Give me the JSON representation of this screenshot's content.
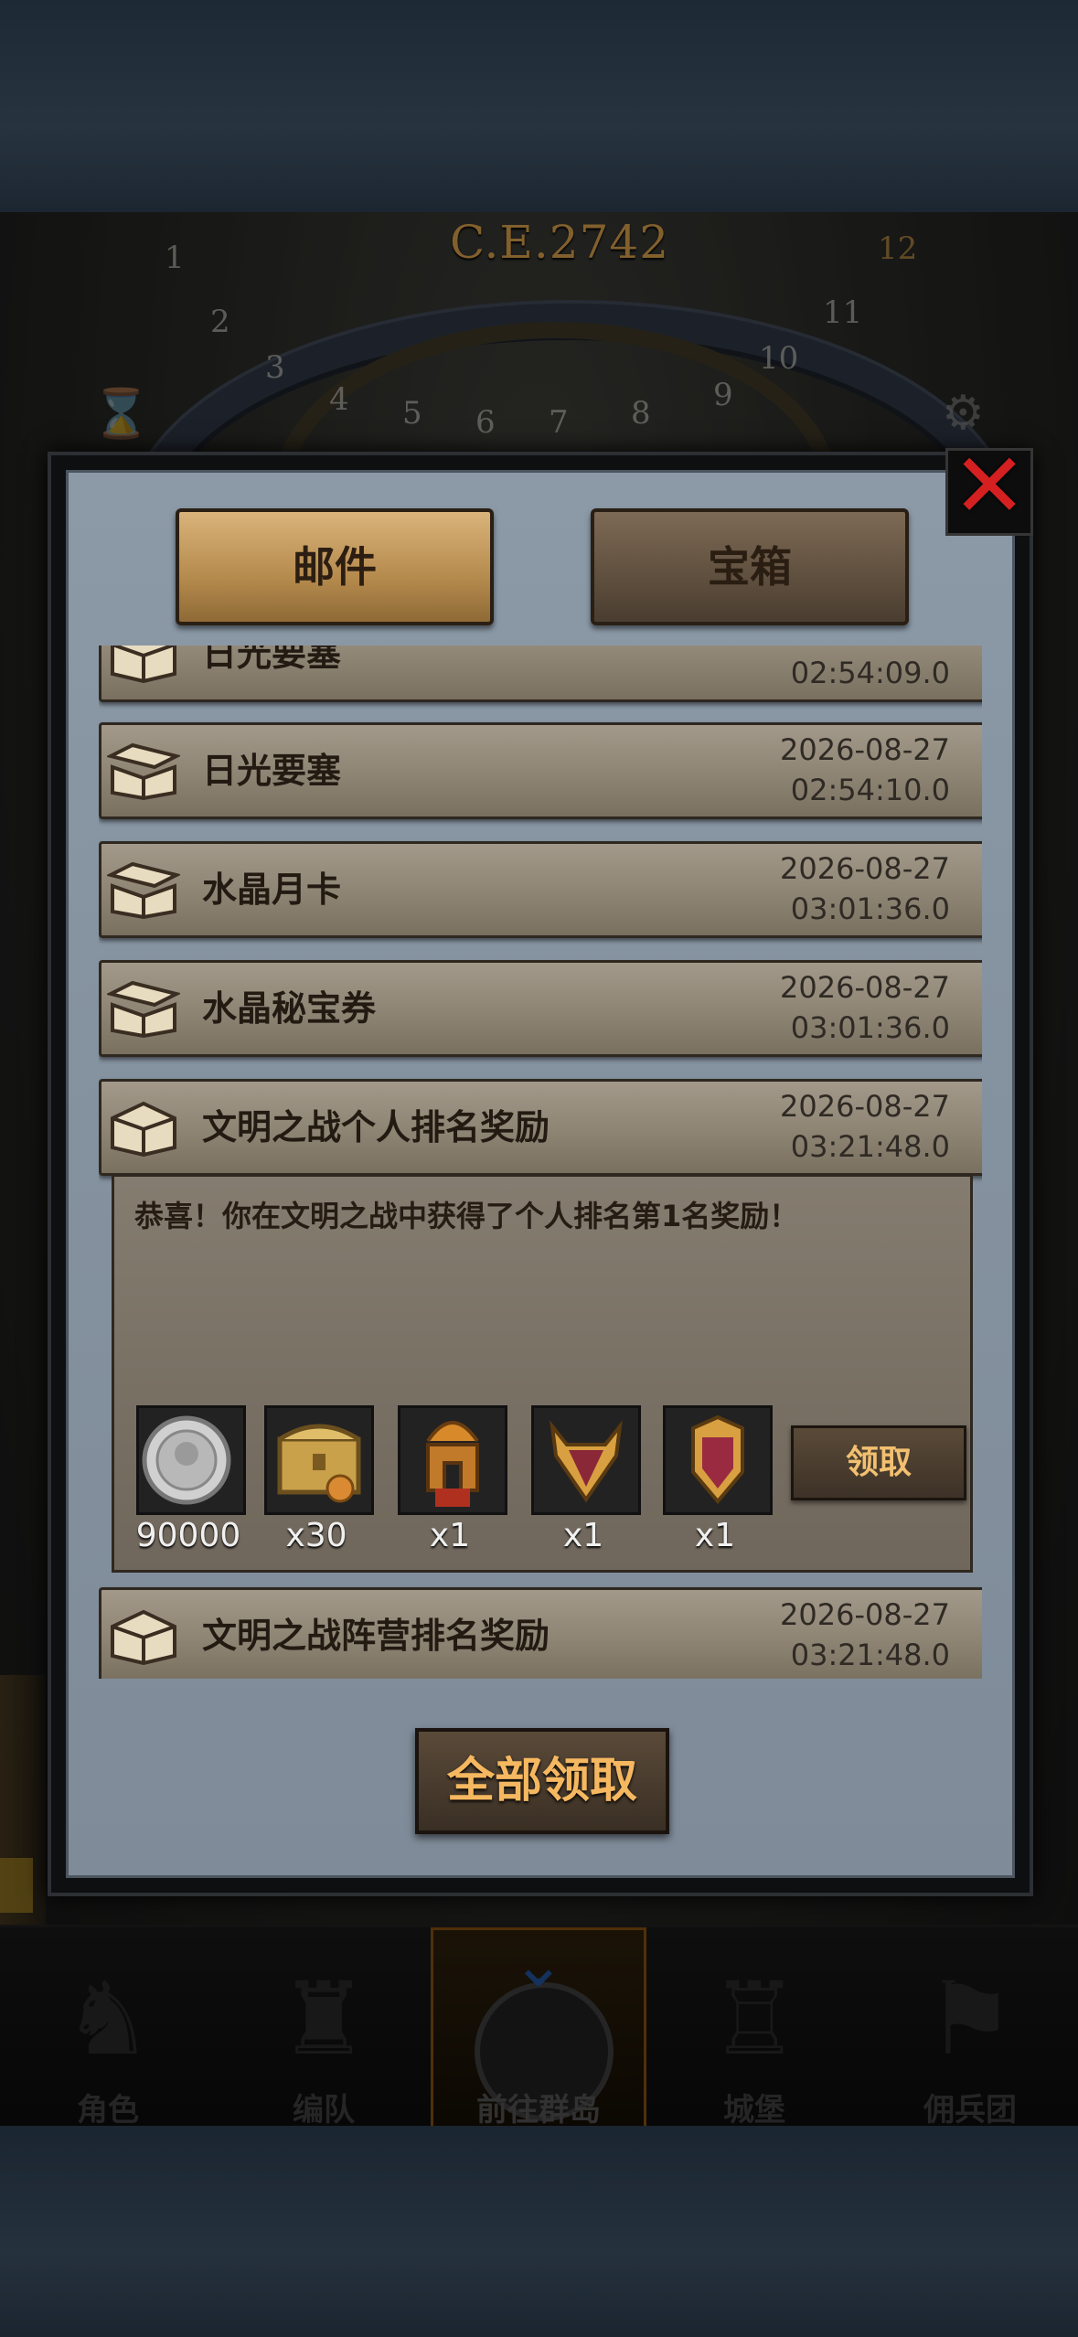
{
  "header": {
    "year": "C.E.2742"
  },
  "dial_numbers": [
    "1",
    "2",
    "3",
    "4",
    "5",
    "6",
    "7",
    "8",
    "9",
    "10",
    "11",
    "12"
  ],
  "tabs": {
    "mail": "邮件",
    "chest": "宝箱"
  },
  "mails": [
    {
      "title": "日光要塞",
      "date": "",
      "time": "02:54:09.0"
    },
    {
      "title": "日光要塞",
      "date": "2026-08-27",
      "time": "02:54:10.0"
    },
    {
      "title": "水晶月卡",
      "date": "2026-08-27",
      "time": "03:01:36.0"
    },
    {
      "title": "水晶秘宝券",
      "date": "2026-08-27",
      "time": "03:01:36.0"
    },
    {
      "title": "文明之战个人排名奖励",
      "date": "2026-08-27",
      "time": "03:21:48.0"
    },
    {
      "title": "文明之战阵营排名奖励",
      "date": "2026-08-27",
      "time": "03:21:48.0"
    }
  ],
  "detail": {
    "message": "恭喜！你在文明之战中获得了个人排名第1名奖励！",
    "rewards": [
      {
        "icon": "silver-coin-icon",
        "count": "90000"
      },
      {
        "icon": "treasure-chest-icon",
        "count": "x30"
      },
      {
        "icon": "spartan-helmet-icon",
        "count": "x1"
      },
      {
        "icon": "horned-shield-icon",
        "count": "x1"
      },
      {
        "icon": "banner-shield-icon",
        "count": "x1"
      }
    ],
    "claim_label": "领取"
  },
  "claim_all_label": "全部领取",
  "bottom_nav": [
    {
      "label": "角色"
    },
    {
      "label": "编队"
    },
    {
      "label": "前往群岛",
      "active": true
    },
    {
      "label": "城堡"
    },
    {
      "label": "佣兵团"
    }
  ],
  "colors": {
    "close": "#d42020",
    "claim_text": "#f2c070",
    "panel_bg": "#8592a0"
  }
}
